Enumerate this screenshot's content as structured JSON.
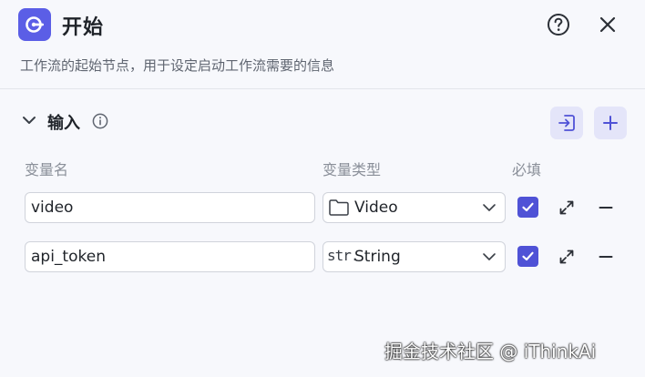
{
  "header": {
    "title": "开始",
    "logo_icon": "start-node-icon",
    "help_icon": "question-circle-icon",
    "close_icon": "close-icon"
  },
  "description": "工作流的起始节点，用于设定启动工作流需要的信息",
  "inputs_section": {
    "title": "输入",
    "toggle_icon": "chevron-down-icon",
    "info_icon": "info-icon",
    "import_button_icon": "import-icon",
    "add_button_icon": "plus-icon",
    "columns": {
      "name": "变量名",
      "type": "变量类型",
      "required": "必填"
    },
    "variables": [
      {
        "name": "video",
        "type_label": "Video",
        "type_icon": "folder-icon",
        "required": true
      },
      {
        "name": "api_token",
        "type_prefix": "str.",
        "type_label": "String",
        "type_icon": "string-icon",
        "required": true
      }
    ]
  },
  "colors": {
    "accent": "#5b5ee6",
    "checkbox": "#4f52d6",
    "background": "#f7f8fc",
    "button_bg": "#e4e5f9"
  },
  "watermark": "掘金技术社区 @ iThinkAi"
}
